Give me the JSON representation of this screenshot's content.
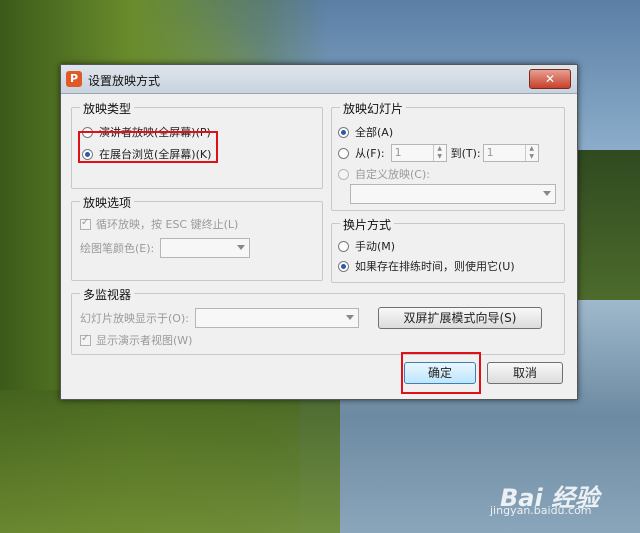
{
  "dialog": {
    "title": "设置放映方式",
    "close_label": "✕",
    "app_icon_letter": "P"
  },
  "show_type": {
    "title": "放映类型",
    "options": [
      {
        "label": "演讲者放映(全屏幕)(P)",
        "selected": false
      },
      {
        "label": "在展台浏览(全屏幕)(K)",
        "selected": true
      }
    ]
  },
  "show_slides": {
    "title": "放映幻灯片",
    "all_label": "全部(A)",
    "from_label": "从(F):",
    "from_value": "1",
    "to_label": "到(T):",
    "to_value": "1",
    "custom_label": "自定义放映(C):"
  },
  "show_options": {
    "title": "放映选项",
    "loop_label": "循环放映，按 ESC 键终止(L)",
    "pen_color_label": "绘图笔颜色(E):"
  },
  "advance": {
    "title": "换片方式",
    "manual_label": "手动(M)",
    "timing_label": "如果存在排练时间，则使用它(U)"
  },
  "monitors": {
    "title": "多监视器",
    "display_on_label": "幻灯片放映显示于(O):",
    "wizard_button": "双屏扩展模式向导(S)",
    "presenter_view_label": "显示演示者视图(W)"
  },
  "buttons": {
    "ok": "确定",
    "cancel": "取消"
  },
  "watermark": {
    "brand": "Bai 经验",
    "url": "jingyan.baidu.com"
  },
  "colors": {
    "highlight": "#e0101a",
    "app_icon": "#e05a28"
  }
}
